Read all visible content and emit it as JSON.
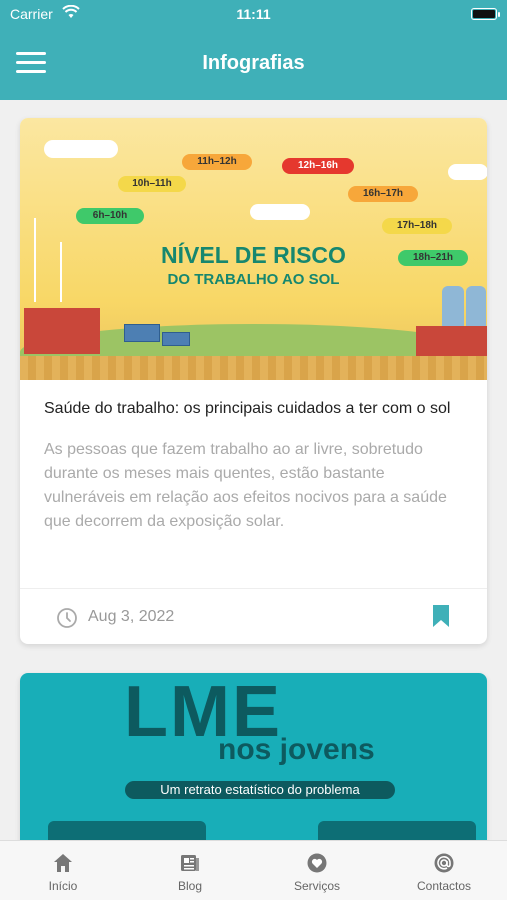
{
  "status_bar": {
    "carrier": "Carrier",
    "time": "11:11"
  },
  "header": {
    "title": "Infografias",
    "menu_icon": "hamburger-menu-icon"
  },
  "cards": [
    {
      "image": {
        "title_line1": "NÍVEL DE RISCO",
        "title_line2": "DO TRABALHO AO SOL",
        "time_labels": [
          "6h–10h",
          "10h–11h",
          "11h–12h",
          "12h–16h",
          "16h–17h",
          "17h–18h",
          "18h–21h"
        ]
      },
      "title": "Saúde do trabalho: os principais cuidados a ter com o sol",
      "description": "As pessoas que fazem trabalho ao ar livre, sobretudo durante os meses mais quentes, estão bastante vulneráveis em relação aos efeitos nocivos para a saúde que decorrem da exposição solar.",
      "date": "Aug 3, 2022",
      "bookmark_icon": "bookmark-icon"
    },
    {
      "image": {
        "title_line1": "LME",
        "title_line2": "nos jovens",
        "subtitle": "Um retrato estatístico do problema"
      }
    }
  ],
  "tabs": [
    {
      "label": "Início",
      "icon": "home-icon"
    },
    {
      "label": "Blog",
      "icon": "blog-icon"
    },
    {
      "label": "Serviços",
      "icon": "heart-icon"
    },
    {
      "label": "Contactos",
      "icon": "at-icon"
    }
  ],
  "colors": {
    "brand": "#3fb0b8",
    "risk_green": "#3fc96a",
    "risk_yellow": "#f4d84a",
    "risk_orange": "#f7a73a",
    "risk_red": "#e5382e"
  }
}
